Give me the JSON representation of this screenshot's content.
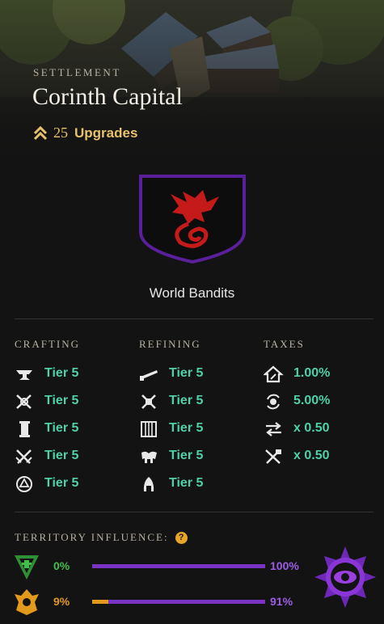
{
  "header": {
    "eyebrow": "SETTLEMENT",
    "title": "Corinth Capital",
    "upgrades_count": "25",
    "upgrades_label": "Upgrades"
  },
  "owner": {
    "name": "World Bandits"
  },
  "crafting": {
    "heading": "CRAFTING",
    "items": [
      {
        "icon": "anvil-icon",
        "value": "Tier 5"
      },
      {
        "icon": "crossed-tools-icon",
        "value": "Tier 5"
      },
      {
        "icon": "scroll-icon",
        "value": "Tier 5"
      },
      {
        "icon": "crossed-swords-icon",
        "value": "Tier 5"
      },
      {
        "icon": "arcane-circle-icon",
        "value": "Tier 5"
      }
    ]
  },
  "refining": {
    "heading": "REFINING",
    "items": [
      {
        "icon": "saw-icon",
        "value": "Tier 5"
      },
      {
        "icon": "smelter-hammer-icon",
        "value": "Tier 5"
      },
      {
        "icon": "loom-icon",
        "value": "Tier 5"
      },
      {
        "icon": "tanning-icon",
        "value": "Tier 5"
      },
      {
        "icon": "stonecutting-icon",
        "value": "Tier 5"
      }
    ]
  },
  "taxes": {
    "heading": "TAXES",
    "items": [
      {
        "icon": "house-tax-icon",
        "value": "1.00%"
      },
      {
        "icon": "coin-cycle-icon",
        "value": "5.00%"
      },
      {
        "icon": "trade-arrows-icon",
        "value": "x 0.50"
      },
      {
        "icon": "crafting-fee-icon",
        "value": "x 0.50"
      }
    ]
  },
  "influence": {
    "heading": "TERRITORY INFLUENCE:",
    "help_icon": "question-mark-icon",
    "help_label": "?",
    "factions": [
      {
        "icon": "covenant-icon",
        "color": "#3fbf4a",
        "start_label": "0%",
        "start_value": 0,
        "end_label": "100%",
        "end_value": 100,
        "start_color": "#3fbf4a",
        "bar_color": "#7a34c4"
      },
      {
        "icon": "marauders-icon",
        "color": "#e39a1c",
        "start_label": "9%",
        "start_value": 9,
        "end_label": "91%",
        "end_value": 91,
        "start_color": "#e39a1c",
        "bar_color": "#7a34c4"
      }
    ],
    "owner_emblem": "syndicate-eye-icon",
    "owner_color": "#9b3fe0"
  },
  "colors": {
    "tier_value": "#4fd0a8",
    "gold": "#e8c26a",
    "purple": "#7a34c4"
  }
}
